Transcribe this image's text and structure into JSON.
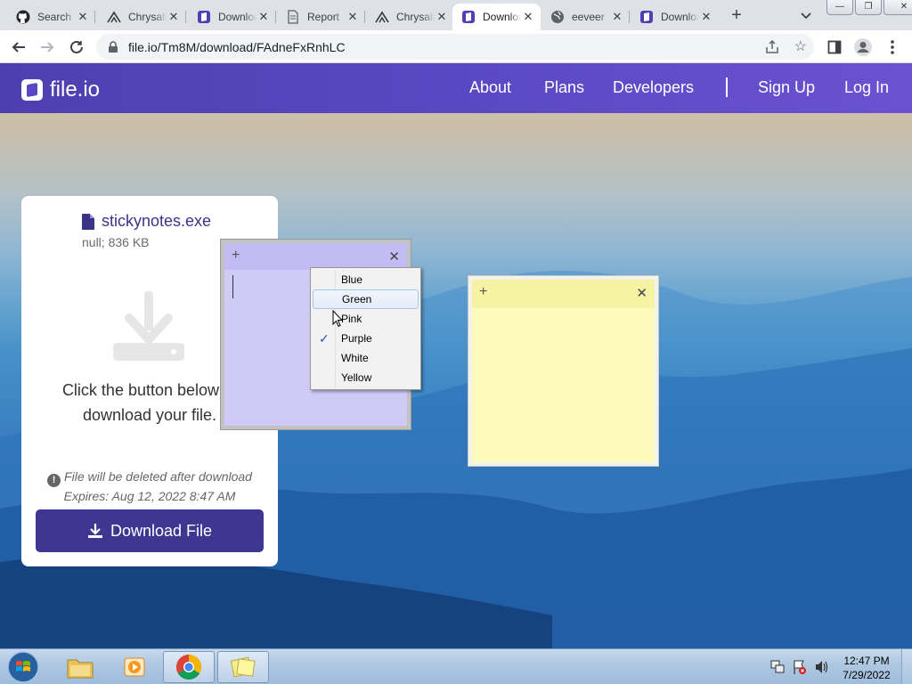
{
  "browser": {
    "tabs": [
      {
        "title": "Search",
        "favicon": "github-icon"
      },
      {
        "title": "Chrysalis",
        "favicon": "chrysalis-icon"
      },
      {
        "title": "Download",
        "favicon": "fileio-icon"
      },
      {
        "title": "Report",
        "favicon": "page-icon"
      },
      {
        "title": "Chrysalis",
        "favicon": "chrysalis-icon"
      },
      {
        "title": "Download",
        "favicon": "fileio-icon"
      },
      {
        "title": "eeveer",
        "favicon": "globe-icon"
      },
      {
        "title": "Download",
        "favicon": "fileio-icon"
      }
    ],
    "active_tab_index": 5,
    "url": "file.io/Tm8M/download/FAdneFxRnhLC",
    "window_controls": {
      "minimize": "—",
      "restore": "❐",
      "close": "✕"
    }
  },
  "site": {
    "brand": "file.io",
    "nav": {
      "about": "About",
      "plans": "Plans",
      "developers": "Developers",
      "sign_up": "Sign Up",
      "log_in": "Log In"
    },
    "header_color": "#5a48c2"
  },
  "file_card": {
    "filename": "stickynotes.exe",
    "meta": "null; 836 KB",
    "instruction_line1": "Click the button below to",
    "instruction_line2": "download your file.",
    "warning": "File will be deleted after download",
    "expires": "Expires: Aug 12, 2022 8:47 AM",
    "download_button": "Download File",
    "button_color": "#3f3692"
  },
  "sticky_notes": {
    "purple": {
      "add": "+",
      "close": "✕",
      "color": "#cfcbf6"
    },
    "yellow": {
      "add": "+",
      "close": "✕",
      "color": "#fdfbbc"
    }
  },
  "color_menu": {
    "items": [
      "Blue",
      "Green",
      "Pink",
      "Purple",
      "White",
      "Yellow"
    ],
    "checked": "Purple",
    "hovered": "Green",
    "check_mark": "✓"
  },
  "taskbar": {
    "time": "12:47 PM",
    "date": "7/29/2022"
  }
}
